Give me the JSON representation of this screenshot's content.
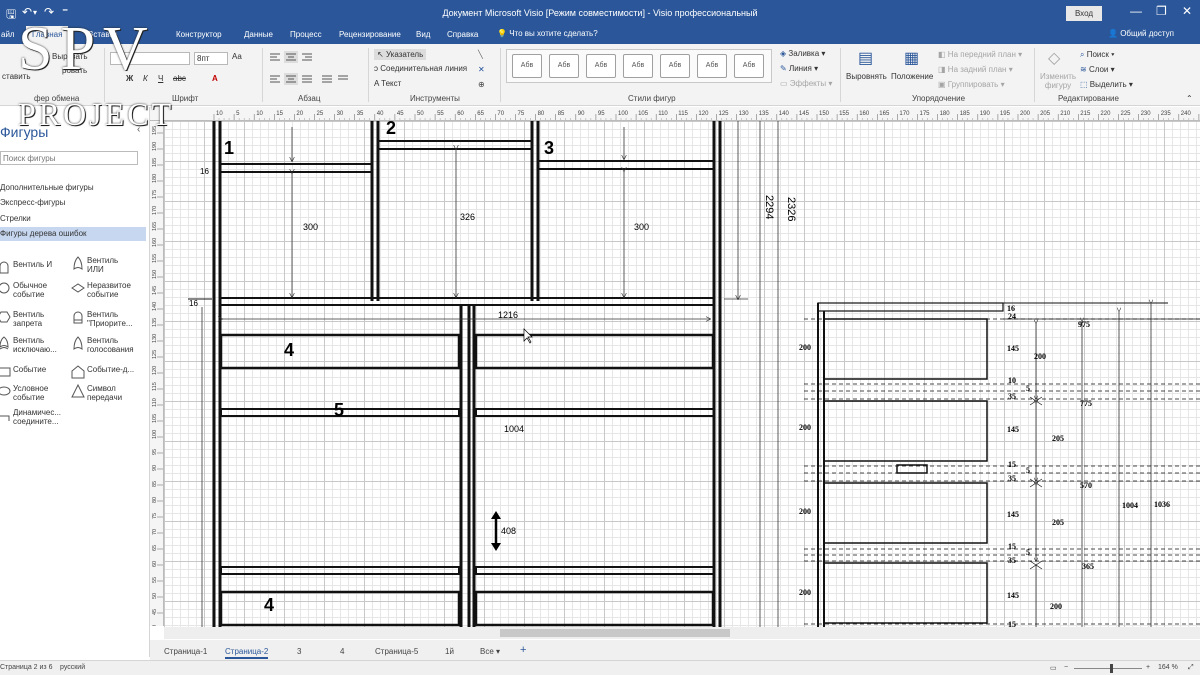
{
  "window": {
    "title": "Документ Microsoft Visio  [Режим совместимости]  -  Visio профессиональный",
    "signin": "Вход",
    "minimize_glyph": "—",
    "restore_glyph": "❐",
    "close_glyph": "✕"
  },
  "qat": {
    "save_glyph": "🖫",
    "undo_glyph": "↶",
    "undo_arrow": "▾",
    "redo_glyph": "↷",
    "customize_glyph": "⁼"
  },
  "tabs": [
    {
      "label": "айл"
    },
    {
      "label": "Главная"
    },
    {
      "label": "Вставка"
    },
    {
      "label": "Конструктор"
    },
    {
      "label": "Данные"
    },
    {
      "label": "Процесс"
    },
    {
      "label": "Рецензирование"
    },
    {
      "label": "Вид"
    },
    {
      "label": "Справка"
    }
  ],
  "tell_me": "Что вы хотите сделать?",
  "share": "Общий доступ",
  "ribbon": {
    "clipboard": {
      "paste": "ставить",
      "cut": "Вырезать",
      "copy": "ровать",
      "painter": "Формат по образцу",
      "label": "фер обмена"
    },
    "font": {
      "family": "",
      "size": "8пт",
      "bold": "Ж",
      "italic": "К",
      "underline": "Ч",
      "strike": "abc",
      "aa": "Aa",
      "color": "A",
      "label": "Шрифт"
    },
    "paragraph": {
      "label": "Абзац"
    },
    "tools": {
      "pointer": "Указатель",
      "connector": "Соединительная линия",
      "text": "Текст",
      "label": "Инструменты"
    },
    "styles": {
      "swatches": [
        "Абв",
        "Абв",
        "Абв",
        "Абв",
        "Абв",
        "Абв",
        "Абв"
      ],
      "label": "Стили фигур"
    },
    "format": {
      "fill": "Заливка",
      "line": "Линия",
      "effects": "Эффекты"
    },
    "arrange": {
      "align": "Выровнять",
      "position": "Положение",
      "front": "На передний план",
      "back": "На задний план",
      "group": "Группировать",
      "label": "Упорядочение"
    },
    "edit": {
      "change_shape": "Изменить фигуру",
      "find": "Поиск",
      "layers": "Слои",
      "select": "Выделить",
      "label": "Редактирование"
    }
  },
  "shapes_panel": {
    "title": "Фигуры",
    "search_placeholder": "Поиск фигуры",
    "collapse_glyph": "‹",
    "stencils": [
      "Дополнительные фигуры",
      "Экспресс-фигуры",
      "Стрелки",
      "Фигуры дерева ошибок"
    ],
    "active_stencil": 3,
    "shapes": [
      {
        "label": "Вентиль И",
        "icon": "and-gate-icon"
      },
      {
        "label": "Вентиль ИЛИ",
        "icon": "or-gate-icon"
      },
      {
        "label": "Обычное событие",
        "icon": "basic-event-icon"
      },
      {
        "label": "Неразвитое событие",
        "icon": "undeveloped-event-icon"
      },
      {
        "label": "Вентиль запрета",
        "icon": "inhibit-gate-icon"
      },
      {
        "label": "Вентиль \"Приорите...",
        "icon": "priority-gate-icon"
      },
      {
        "label": "Вентиль исключаю...",
        "icon": "exclusive-gate-icon"
      },
      {
        "label": "Вентиль голосования",
        "icon": "voting-gate-icon"
      },
      {
        "label": "Событие",
        "icon": "event-icon"
      },
      {
        "label": "Событие-д...",
        "icon": "house-event-icon"
      },
      {
        "label": "Условное событие",
        "icon": "conditional-event-icon"
      },
      {
        "label": "Символ передачи",
        "icon": "transfer-icon"
      },
      {
        "label": "Динамичес... соедините...",
        "icon": "dynamic-connector-icon"
      }
    ]
  },
  "ruler": {
    "top": [
      "10",
      "5",
      "10",
      "15",
      "20",
      "25",
      "30",
      "35",
      "40",
      "45",
      "50",
      "55",
      "60",
      "65",
      "70",
      "75",
      "80",
      "85",
      "90",
      "95",
      "100",
      "105",
      "110",
      "115",
      "120",
      "125",
      "130",
      "135",
      "140",
      "145",
      "150",
      "155",
      "160",
      "165",
      "170",
      "175",
      "180",
      "185",
      "190",
      "195",
      "200",
      "205",
      "210",
      "215",
      "220",
      "225",
      "230",
      "235",
      "240",
      "245",
      "250"
    ],
    "left": [
      "195",
      "190",
      "185",
      "180",
      "175",
      "170",
      "165",
      "160",
      "155",
      "150",
      "145",
      "140",
      "135",
      "130",
      "125",
      "120",
      "115",
      "110",
      "105",
      "100",
      "95",
      "90",
      "85",
      "80",
      "75",
      "70",
      "65",
      "60",
      "55",
      "50",
      "45",
      "40"
    ]
  },
  "drawing": {
    "main": {
      "labels": {
        "n1": "1",
        "n2": "2",
        "n3": "3",
        "n4a": "4",
        "n5": "5",
        "n4b": "4"
      },
      "dims": {
        "d300a": "300",
        "d326": "326",
        "d300b": "300",
        "d16a": "16",
        "d16b": "16",
        "d1216": "1216",
        "d1004": "1004",
        "d408": "408",
        "d2294": "2294",
        "d2326": "2326"
      }
    },
    "side": {
      "d200s": [
        "200",
        "200",
        "200",
        "200"
      ],
      "right_labels": [
        "16",
        "24",
        "145",
        "200",
        "975",
        "10",
        "5",
        "35",
        "775",
        "145",
        "205",
        "15",
        "5",
        "35",
        "570",
        "1004",
        "1036",
        "145",
        "205",
        "15",
        "5",
        "35",
        "365",
        "145",
        "200",
        "15"
      ]
    }
  },
  "pages": [
    "Страница-1",
    "Страница-2",
    "3",
    "4",
    "Страница-5",
    "1й",
    "Все"
  ],
  "active_page": 1,
  "add_page_glyph": "+",
  "all_arrow": "▾",
  "status": {
    "page": "Страница 2 из 6",
    "lang": "русский",
    "zoom": "164 %"
  },
  "watermark": {
    "line1": "SPV",
    "line2": "PROJECT"
  }
}
